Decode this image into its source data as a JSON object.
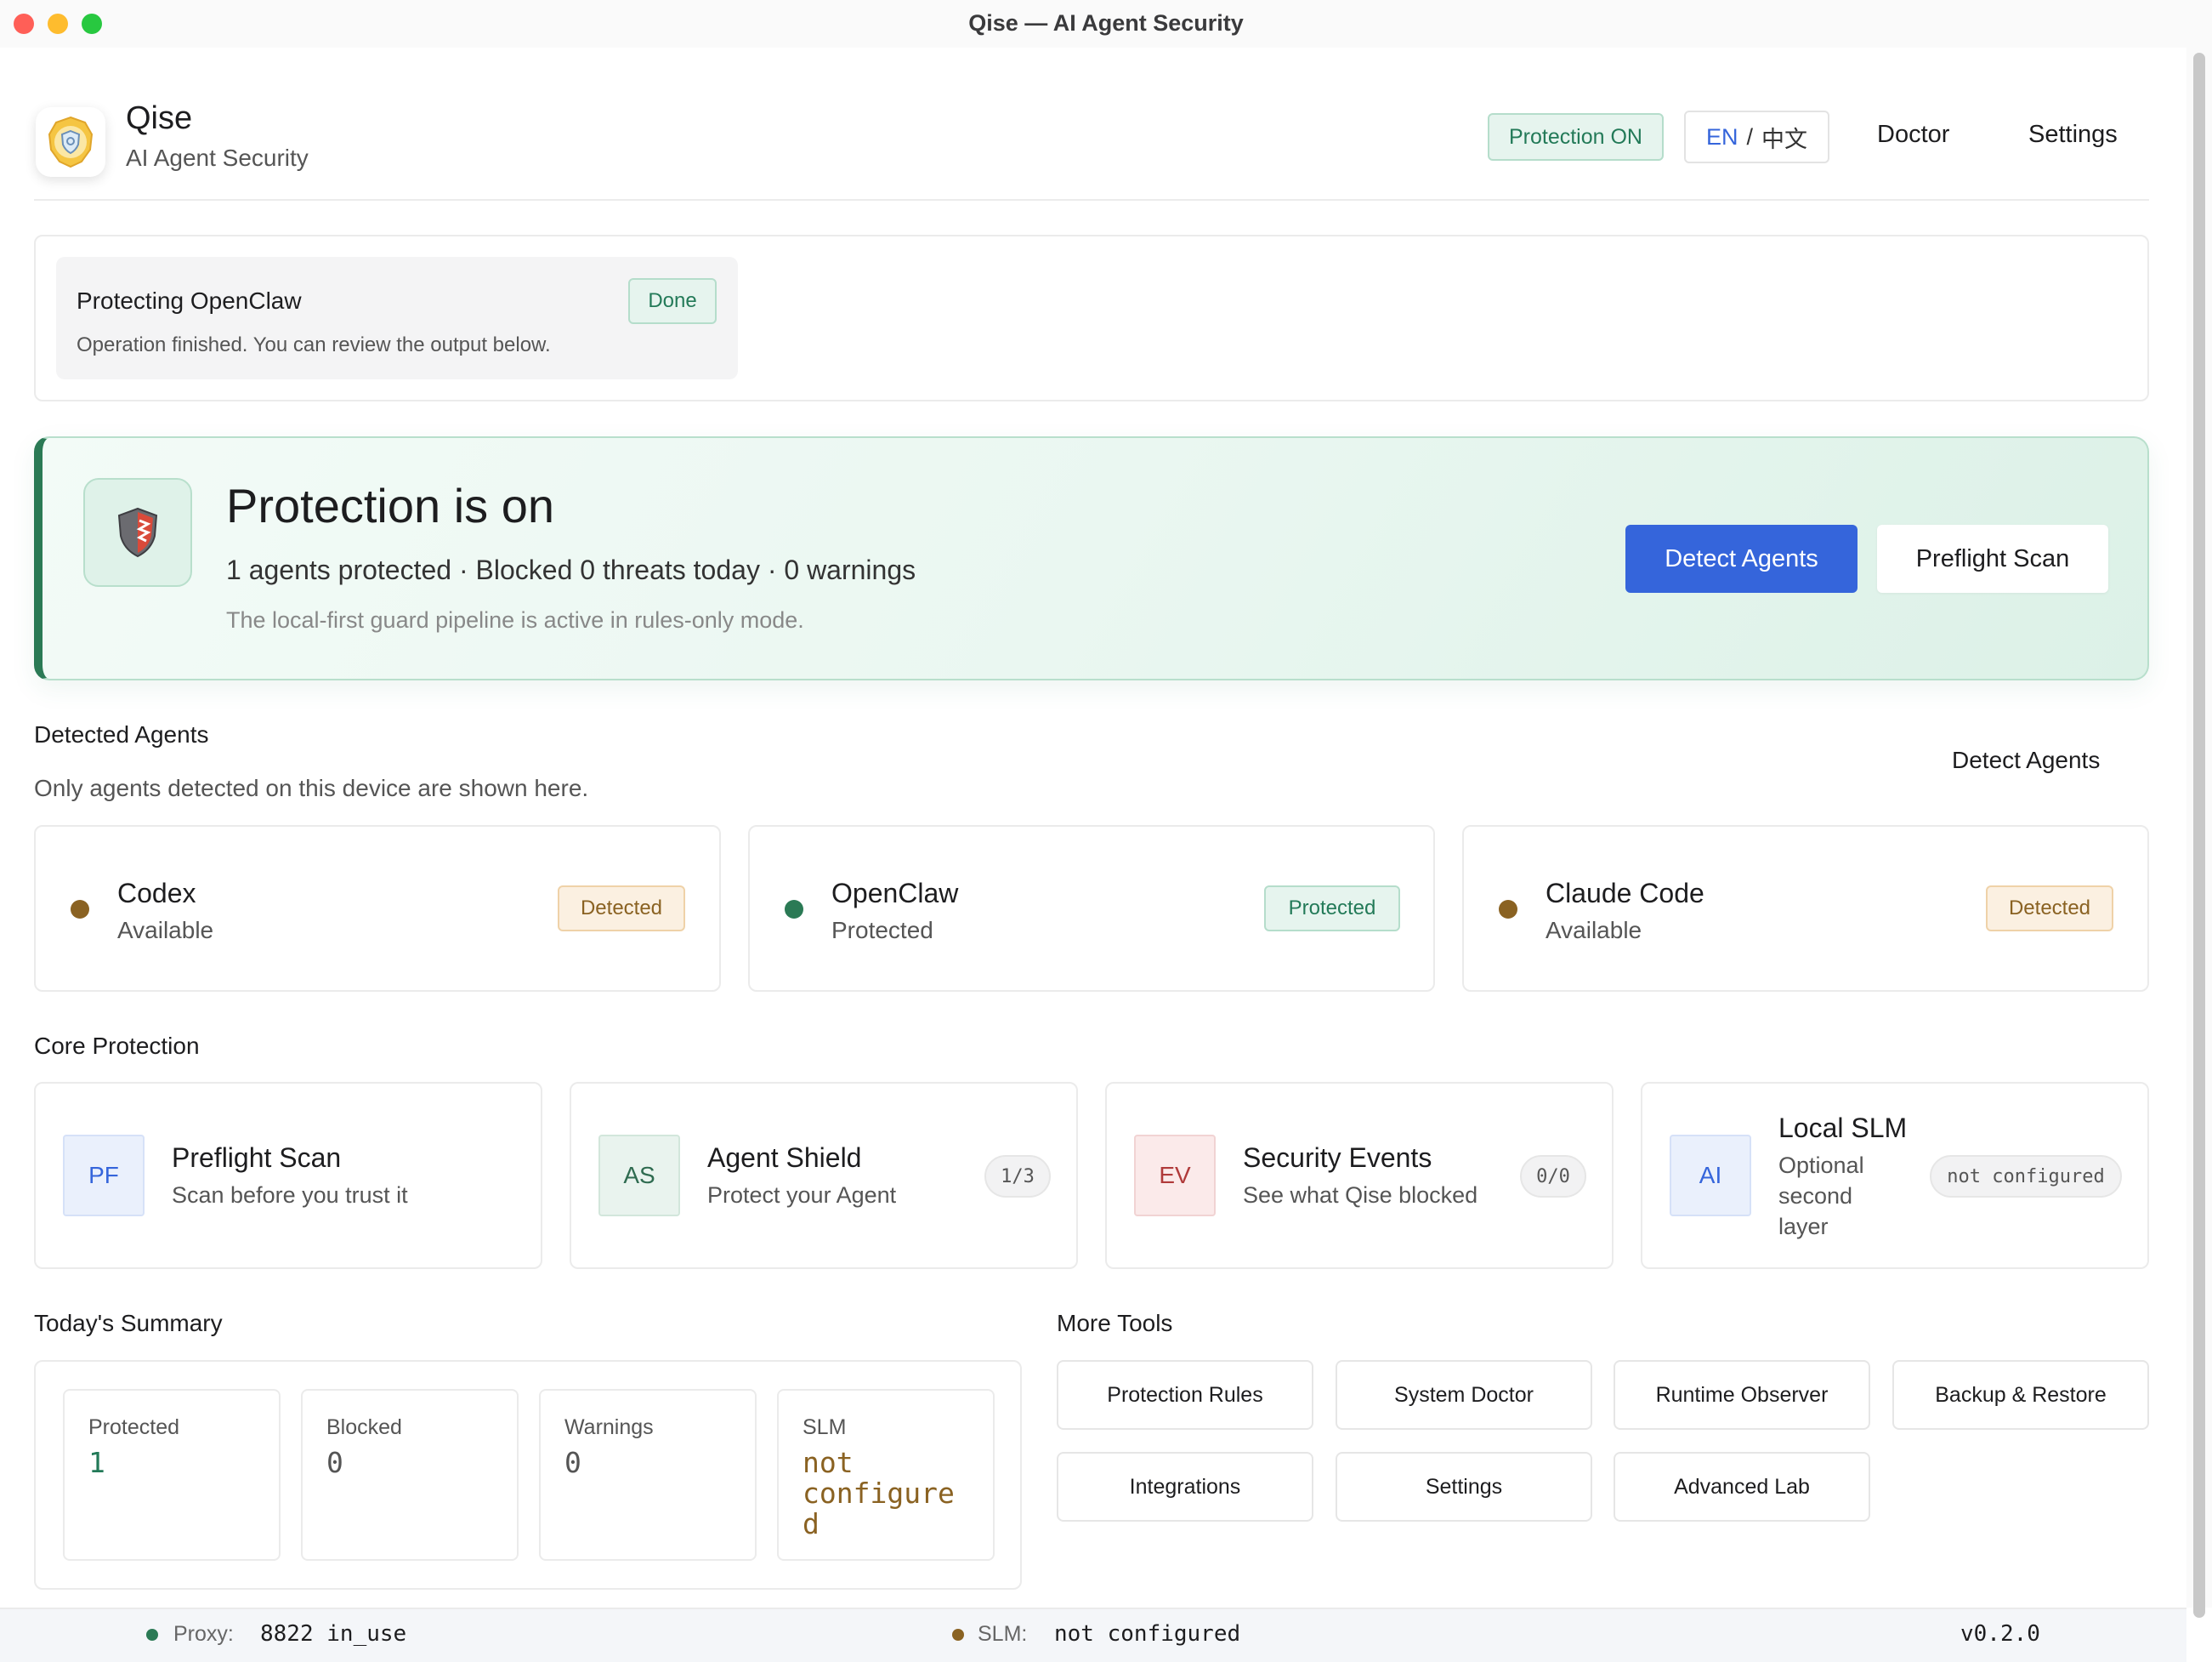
{
  "window": {
    "title": "Qise — AI Agent Security"
  },
  "header": {
    "app_name": "Qise",
    "app_subtitle": "AI Agent Security",
    "protection_badge": "Protection ON",
    "lang_en": "EN",
    "lang_sep": "/",
    "lang_zh": "中文",
    "doctor": "Doctor",
    "settings": "Settings"
  },
  "operation": {
    "title": "Protecting OpenClaw",
    "description": "Operation finished. You can review the output below.",
    "status": "Done"
  },
  "hero": {
    "title": "Protection is on",
    "stats": "1 agents protected · Blocked 0 threats today · 0 warnings",
    "note": "The local-first guard pipeline is active in rules-only mode.",
    "primary_button": "Detect Agents",
    "secondary_button": "Preflight Scan"
  },
  "detected_agents": {
    "title": "Detected Agents",
    "subtitle": "Only agents detected on this device are shown here.",
    "action": "Detect Agents",
    "agents": [
      {
        "name": "Codex",
        "status": "Available",
        "badge": "Detected",
        "dot_color": "#8a6222"
      },
      {
        "name": "OpenClaw",
        "status": "Protected",
        "badge": "Protected",
        "dot_color": "#2b7a55"
      },
      {
        "name": "Claude Code",
        "status": "Available",
        "badge": "Detected",
        "dot_color": "#8a6222"
      }
    ]
  },
  "core_protection": {
    "title": "Core Protection",
    "items": [
      {
        "code": "PF",
        "name": "Preflight Scan",
        "desc": "Scan before you trust it",
        "pill": ""
      },
      {
        "code": "AS",
        "name": "Agent Shield",
        "desc": "Protect your Agent",
        "pill": "1/3"
      },
      {
        "code": "EV",
        "name": "Security Events",
        "desc": "See what Qise blocked",
        "pill": "0/0"
      },
      {
        "code": "AI",
        "name": "Local SLM",
        "desc_lines": [
          "Optional",
          "second",
          "layer"
        ],
        "pill": "not configured"
      }
    ]
  },
  "summary": {
    "title": "Today's Summary",
    "cards": [
      {
        "label": "Protected",
        "value": "1"
      },
      {
        "label": "Blocked",
        "value": "0"
      },
      {
        "label": "Warnings",
        "value": "0"
      },
      {
        "label": "SLM",
        "value_lines": [
          "not",
          "configure",
          "d"
        ]
      }
    ]
  },
  "more_tools": {
    "title": "More Tools",
    "items": [
      "Protection Rules",
      "System Doctor",
      "Runtime Observer",
      "Backup & Restore",
      "Integrations",
      "Settings",
      "Advanced Lab"
    ]
  },
  "statusbar": {
    "proxy_label": "Proxy:",
    "proxy_value": "8822 in_use",
    "slm_label": "SLM:",
    "slm_value": "not configured",
    "version": "v0.2.0"
  },
  "colors": {
    "accent": "#3565db",
    "success": "#2b7a55",
    "warning": "#8a6222",
    "danger": "#b03a3a"
  },
  "icons": {
    "app_logo": "shield-badge-icon",
    "hero": "shield-icon"
  }
}
